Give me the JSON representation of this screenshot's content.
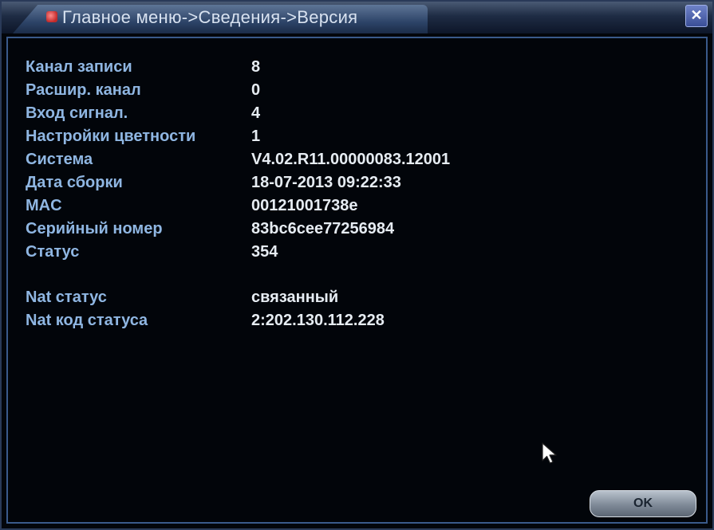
{
  "window": {
    "title": "Главное меню->Сведения->Версия",
    "close_label": "✕"
  },
  "info": {
    "rows": [
      {
        "label": "Канал записи",
        "value": "8"
      },
      {
        "label": "Расшир. канал",
        "value": "0"
      },
      {
        "label": "Вход сигнал.",
        "value": "4"
      },
      {
        "label": "Настройки цветности",
        "value": "1"
      },
      {
        "label": "Система",
        "value": "V4.02.R11.00000083.12001"
      },
      {
        "label": "Дата сборки",
        "value": "18-07-2013 09:22:33"
      },
      {
        "label": "MAC",
        "value": "00121001738e"
      },
      {
        "label": "Серийный номер",
        "value": "83bc6cee77256984"
      },
      {
        "label": "Статус",
        "value": "354"
      },
      {
        "label": "Nat статус",
        "value": "связанный"
      },
      {
        "label": "Nat код статуса",
        "value": "2:202.130.112.228"
      }
    ]
  },
  "buttons": {
    "ok_label": "OK"
  },
  "colors": {
    "label": "#8fb6e2",
    "value": "#e6ecf2",
    "frame": "#3a5a8a",
    "background": "#03060b"
  }
}
